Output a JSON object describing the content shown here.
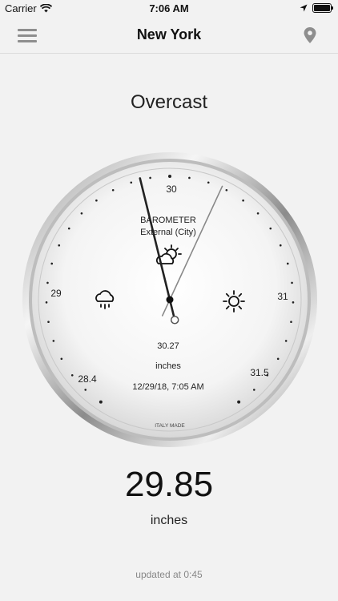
{
  "status_bar": {
    "carrier": "Carrier",
    "time": "7:06 AM",
    "icons": [
      "wifi-icon",
      "location-arrow-icon",
      "battery-icon"
    ]
  },
  "nav": {
    "title": "New York",
    "left_icon": "menu-icon",
    "right_icon": "location-pin-icon"
  },
  "condition": "Overcast",
  "gauge": {
    "title": "BAROMETER",
    "subtitle": "External (City)",
    "scale_labels": {
      "top": "30",
      "left": "29",
      "right": "31",
      "lower_left": "28.4",
      "lower_right": "31.5"
    },
    "reference_value": "30.27",
    "unit": "inches",
    "timestamp": "12/29/18, 7:05 AM",
    "maker": "ITALY MADE",
    "icons": [
      "rain-cloud-icon",
      "partly-cloudy-icon",
      "sun-icon"
    ],
    "current_needle_value": 29.85,
    "reference_needle_value": 30.27
  },
  "reading": {
    "value": "29.85",
    "unit": "inches"
  },
  "updated": "updated at 0:45",
  "colors": {
    "background": "#f2f2f2",
    "nav_icon": "#8e8e8e",
    "needle": "#222222",
    "reference_needle": "#888888"
  }
}
